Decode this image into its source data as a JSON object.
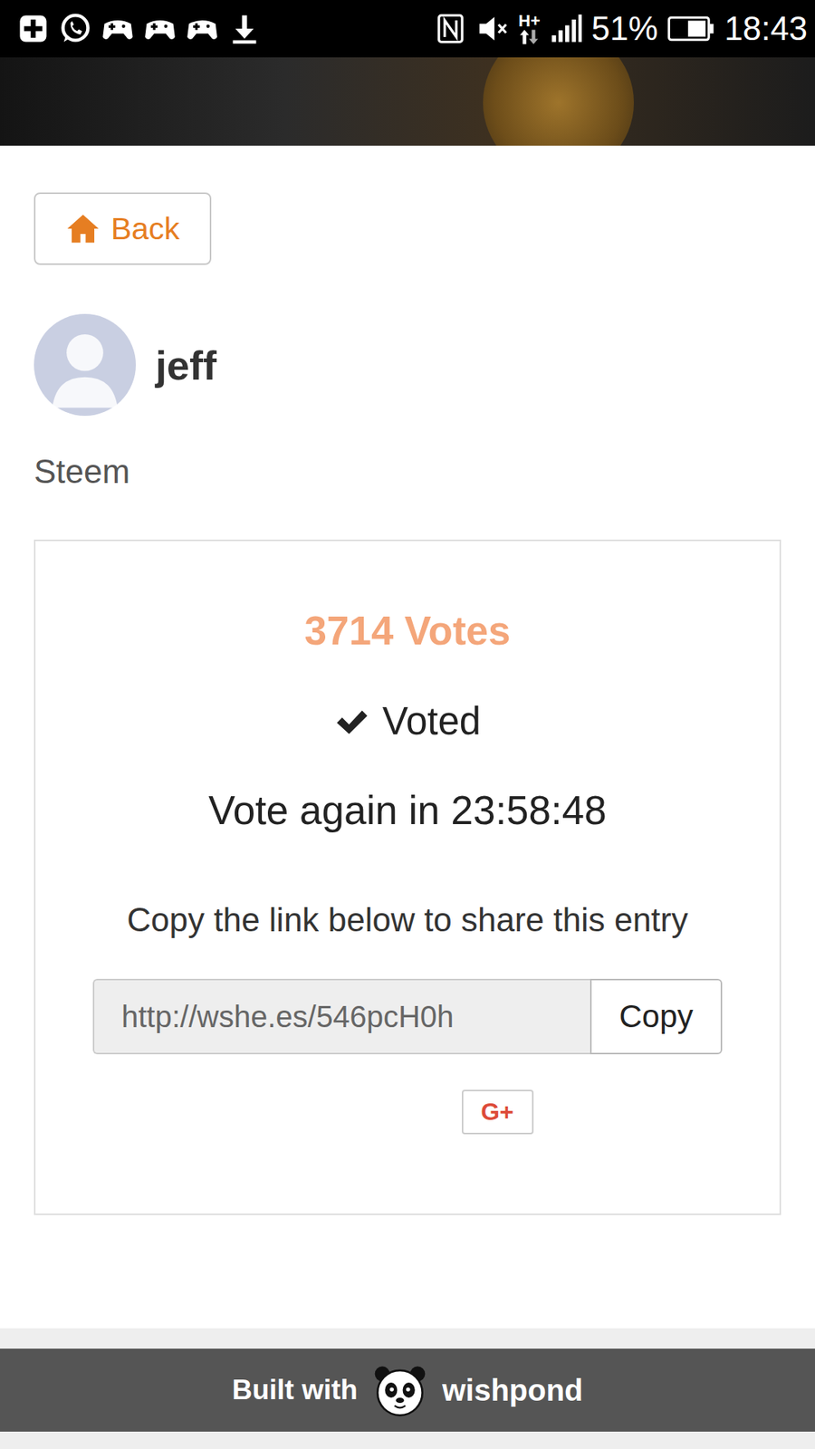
{
  "status_bar": {
    "network": "H+",
    "battery": "51%",
    "time": "18:43"
  },
  "header": {
    "back": "Back"
  },
  "entry": {
    "name": "jeff",
    "description": "Steem"
  },
  "vote": {
    "count": "3714 Votes",
    "status": "Voted",
    "voted": true,
    "countdown": "Vote again in 23:58:48"
  },
  "share": {
    "prompt": "Copy the link below to share this entry",
    "url": "http://wshe.es/546pcH0h",
    "copy": "Copy",
    "social": [
      "G+"
    ]
  },
  "footer": {
    "built_with": "Built with",
    "brand": "wishpond"
  }
}
